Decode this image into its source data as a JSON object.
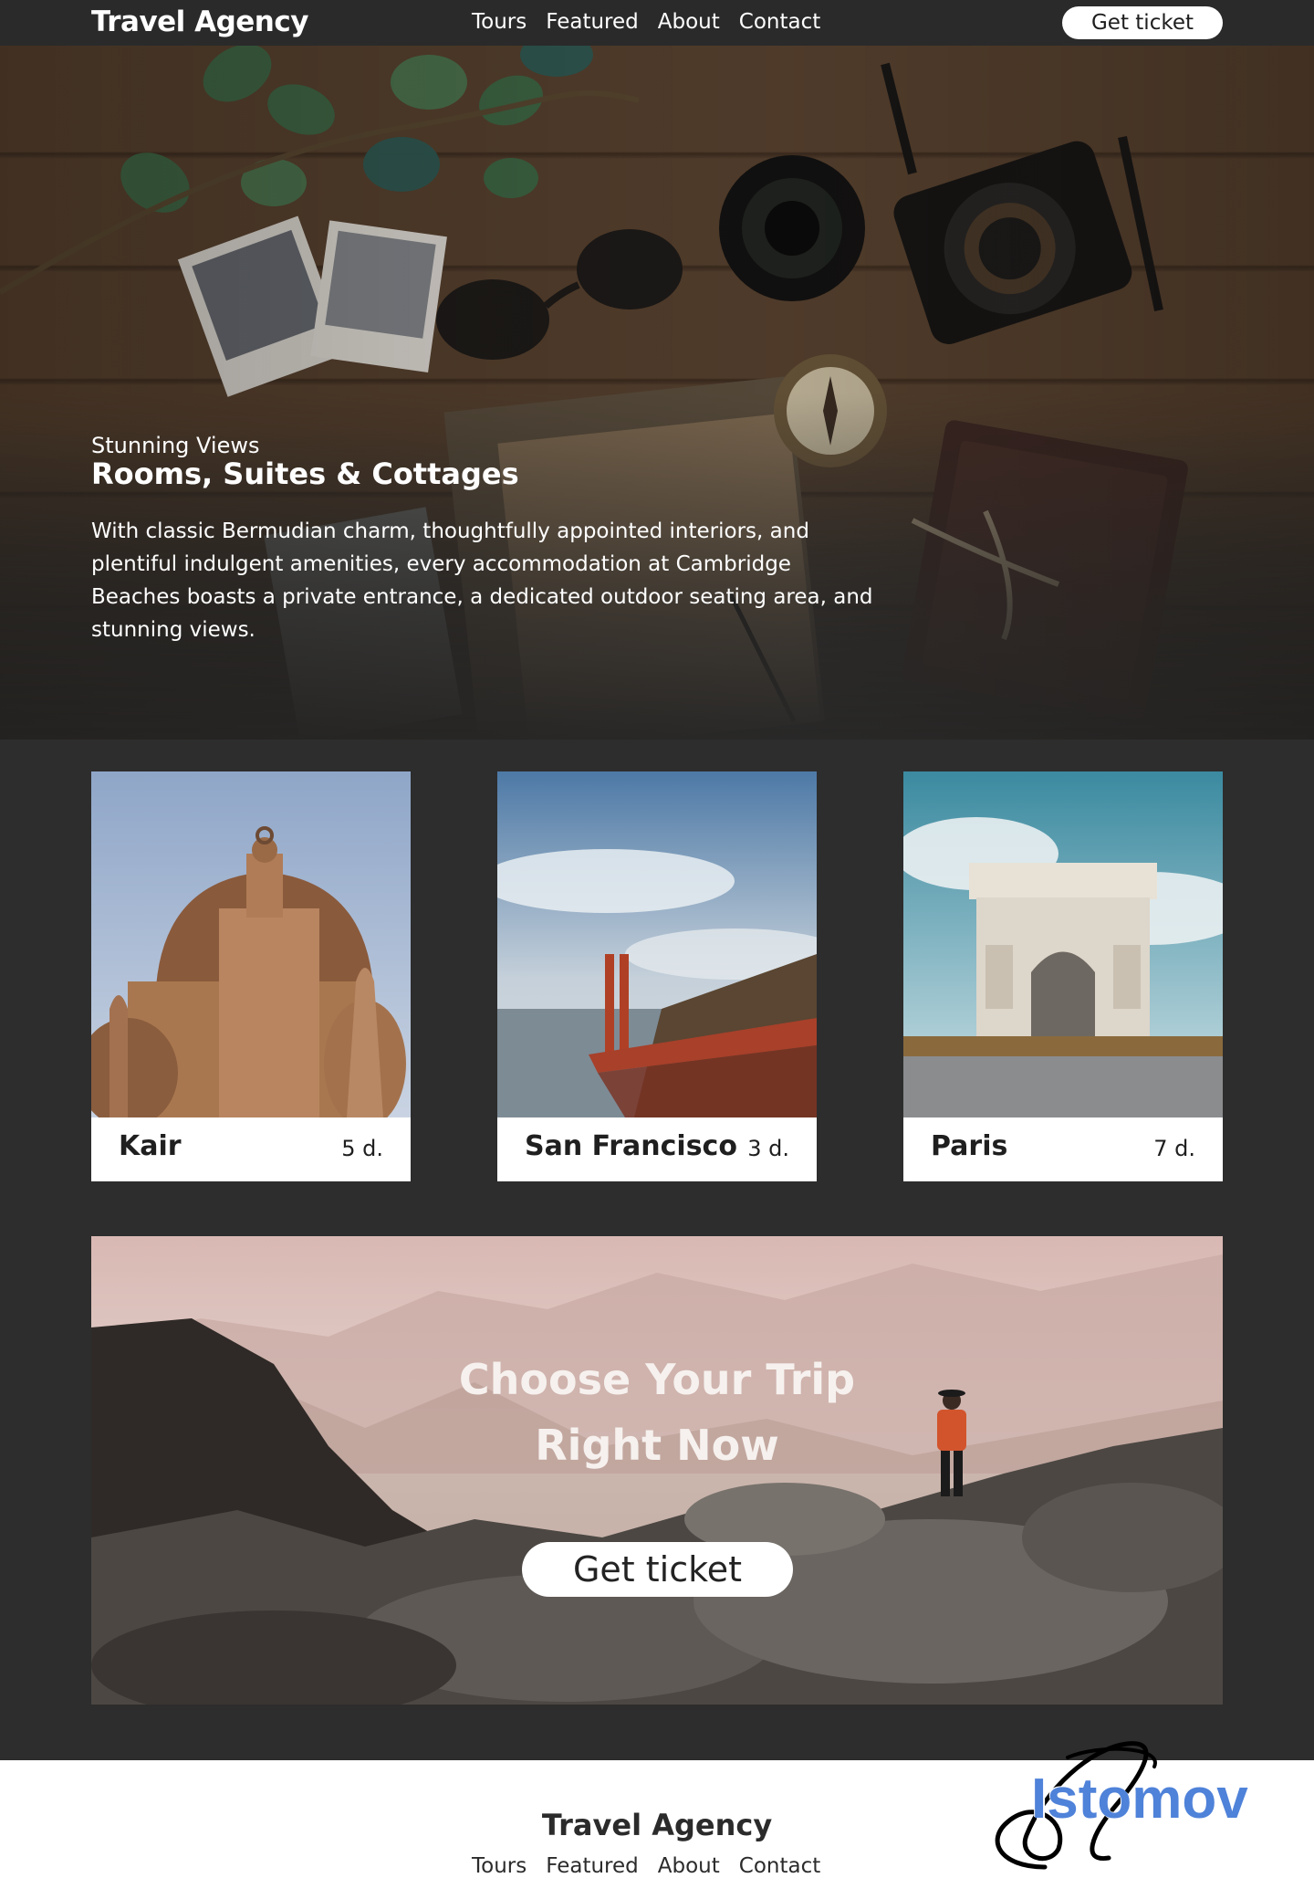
{
  "header": {
    "logo": "Travel Agency",
    "nav": [
      "Tours",
      "Featured",
      "About",
      "Contact"
    ],
    "cta": "Get ticket"
  },
  "hero": {
    "eyebrow": "Stunning Views",
    "title": "Rooms, Suites & Cottages",
    "text": "With classic Bermudian charm, thoughtfully appointed interiors, and plentiful indulgent amenities, every accommodation at Cambridge Beaches boasts a private entrance, a dedicated outdoor seating area, and stunning views."
  },
  "tours": [
    {
      "name": "Kair",
      "days": "5 d."
    },
    {
      "name": "San Francisco",
      "days": "3 d."
    },
    {
      "name": "Paris",
      "days": "7 d."
    }
  ],
  "banner": {
    "title_line1": "Choose Your Trip",
    "title_line2": "Right Now",
    "button": "Get ticket"
  },
  "footer": {
    "logo": "Travel Agency",
    "nav": [
      "Tours",
      "Featured",
      "About",
      "Contact"
    ]
  },
  "watermark": {
    "text": "Istomov"
  },
  "colors": {
    "page_bg": "#2d2d2d",
    "header_bg": "#2a2a2a",
    "signature_blue": "#4f82d9"
  }
}
